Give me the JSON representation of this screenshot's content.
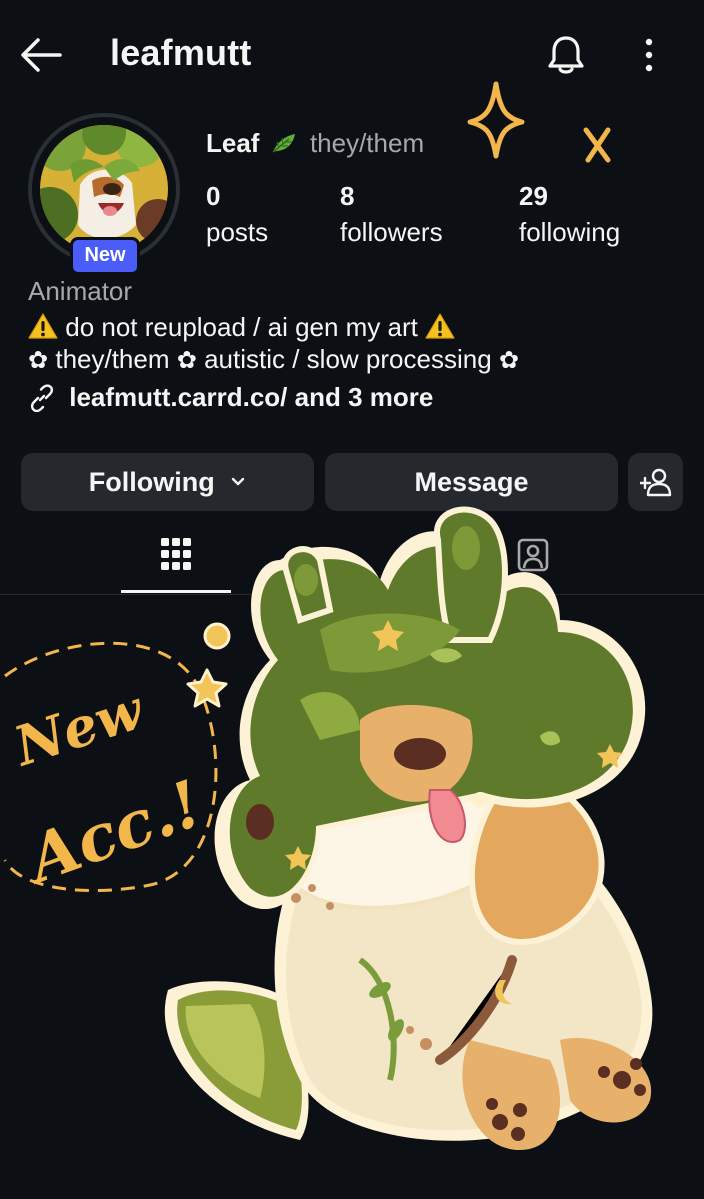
{
  "header": {
    "username": "leafmutt"
  },
  "profile": {
    "display_name": "Leaf",
    "pronouns": "they/them",
    "badge": "New",
    "stats": [
      {
        "value": "0",
        "label": "posts"
      },
      {
        "value": "8",
        "label": "followers"
      },
      {
        "value": "29",
        "label": "following"
      }
    ],
    "category": "Animator",
    "bio": {
      "line1": "do not reupload / ai gen my art",
      "line2_a": "they/them",
      "line2_b": "autistic / slow processing",
      "link": "leafmutt.carrd.co/ and 3 more"
    }
  },
  "actions": {
    "following_label": "Following",
    "message_label": "Message"
  },
  "icons": [
    "back-arrow-icon",
    "bell-icon",
    "more-vertical-icon",
    "leaf-icon",
    "warning-icon",
    "flower-icon",
    "link-icon",
    "chevron-down-icon",
    "add-person-icon",
    "grid-icon",
    "tagged-icon"
  ],
  "artwork": {
    "text_line1": "New",
    "text_line2": "Acc.!"
  },
  "colors": {
    "background": "#0c1014",
    "button": "#25292e",
    "badge": "#4a5df9",
    "secondary_text": "#a8a8a8",
    "sticker_gold": "#f2b64a",
    "fur_green": "#5e7a2a"
  }
}
